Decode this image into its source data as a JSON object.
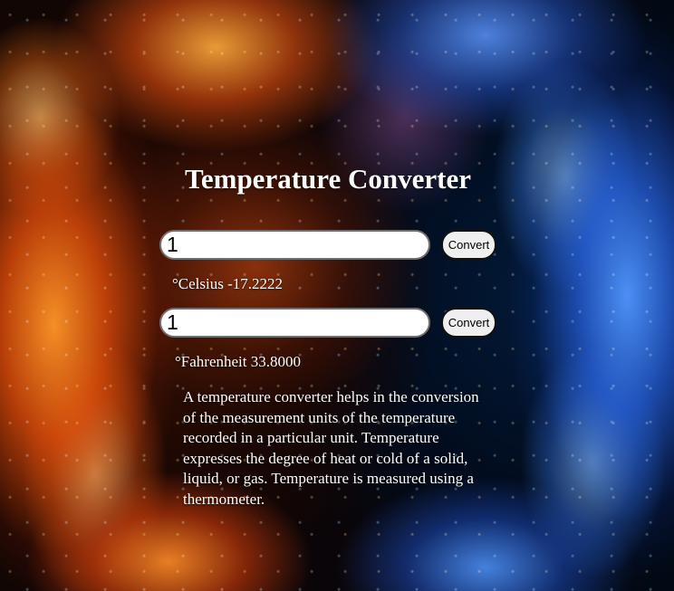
{
  "page": {
    "title": "Temperature Converter"
  },
  "celsius_converter": {
    "input_value": "1",
    "button_label": "Convert",
    "result_text": "°Celsius -17.2222"
  },
  "fahrenheit_converter": {
    "input_value": "1",
    "button_label": "Convert",
    "result_text": "°Fahrenheit 33.8000"
  },
  "description": "A temperature converter helps in the conversion of the measurement units of the temperature recorded in a particular unit. Temperature expresses the degree of heat or cold of a solid, liquid, or gas. Temperature is measured using a thermometer.",
  "theme": {
    "background": "fire-and-ice",
    "fire_color": "#ff8a1e",
    "ice_color": "#4a8cff",
    "text_color": "#ffffff"
  }
}
